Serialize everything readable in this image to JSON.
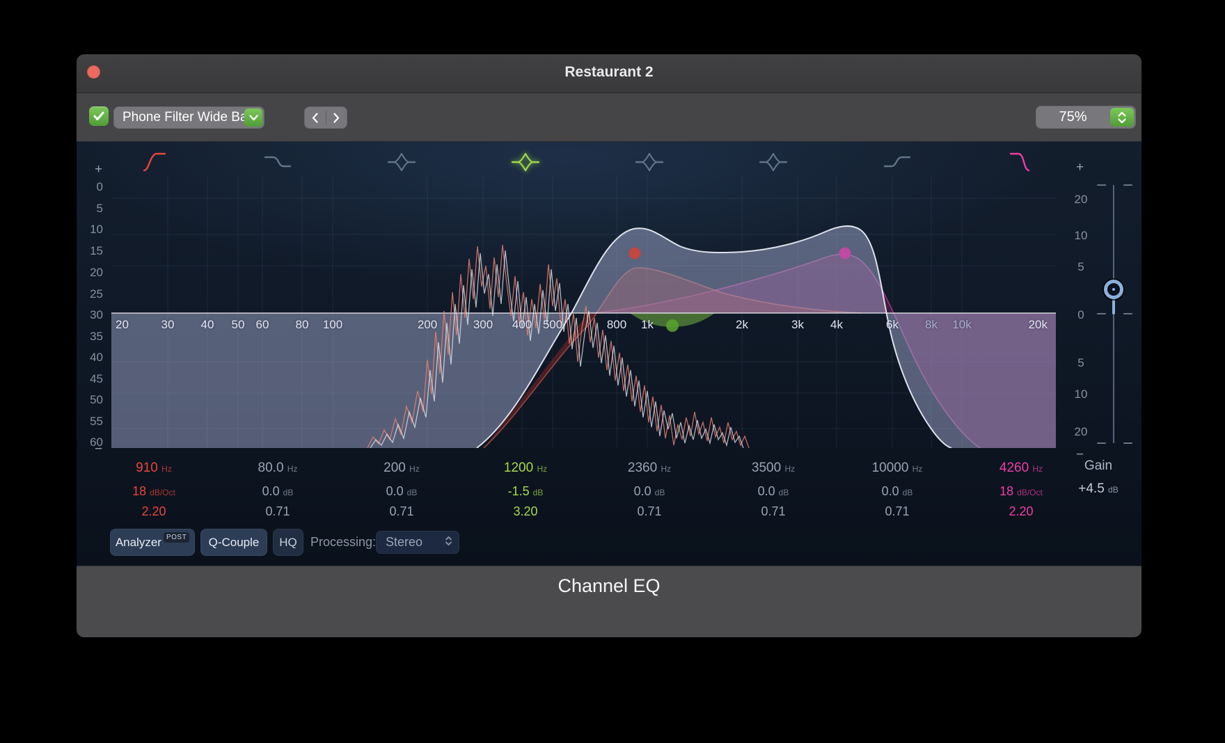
{
  "window": {
    "title": "Restaurant 2",
    "plugin_name": "Channel EQ"
  },
  "toolbar": {
    "preset": "Phone Filter Wide Ba...",
    "prev": "‹",
    "next": "›",
    "zoom": "75%"
  },
  "bands": [
    {
      "id": 1,
      "type": "highpass",
      "freq": "910",
      "freq_unit": "Hz",
      "gain": "18",
      "gain_unit": "dB/Oct",
      "q": "2.20",
      "color": "#e8453c",
      "selected": false
    },
    {
      "id": 2,
      "type": "low-shelf",
      "freq": "80.0",
      "freq_unit": "Hz",
      "gain": "0.0",
      "gain_unit": "dB",
      "q": "0.71",
      "color": "#98a3b3",
      "selected": false
    },
    {
      "id": 3,
      "type": "bell",
      "freq": "200",
      "freq_unit": "Hz",
      "gain": "0.0",
      "gain_unit": "dB",
      "q": "0.71",
      "color": "#98a3b3",
      "selected": false
    },
    {
      "id": 4,
      "type": "bell",
      "freq": "1200",
      "freq_unit": "Hz",
      "gain": "-1.5",
      "gain_unit": "dB",
      "q": "3.20",
      "color": "#a5d94d",
      "selected": true
    },
    {
      "id": 5,
      "type": "bell",
      "freq": "2360",
      "freq_unit": "Hz",
      "gain": "0.0",
      "gain_unit": "dB",
      "q": "0.71",
      "color": "#98a3b3",
      "selected": false
    },
    {
      "id": 6,
      "type": "bell",
      "freq": "3500",
      "freq_unit": "Hz",
      "gain": "0.0",
      "gain_unit": "dB",
      "q": "0.71",
      "color": "#98a3b3",
      "selected": false
    },
    {
      "id": 7,
      "type": "high-shelf",
      "freq": "10000",
      "freq_unit": "Hz",
      "gain": "0.0",
      "gain_unit": "dB",
      "q": "0.71",
      "color": "#98a3b3",
      "selected": false
    },
    {
      "id": 8,
      "type": "lowpass",
      "freq": "4260",
      "freq_unit": "Hz",
      "gain": "18",
      "gain_unit": "dB/Oct",
      "q": "2.20",
      "color": "#ee3da6",
      "selected": false
    }
  ],
  "master_gain": {
    "label": "Gain",
    "value": "+4.5",
    "unit": "dB"
  },
  "controls": {
    "analyzer": "Analyzer",
    "analyzer_mode": "POST",
    "q_couple": "Q-Couple",
    "hq": "HQ",
    "processing_label": "Processing:",
    "processing_value": "Stereo"
  },
  "scales": {
    "freq_labels": [
      "20",
      "30",
      "40",
      "50",
      "60",
      "80",
      "100",
      "200",
      "300",
      "400",
      "500",
      "800",
      "1k",
      "2k",
      "3k",
      "4k",
      "6k",
      "8k",
      "10k",
      "20k"
    ],
    "analyzer_db_labels": [
      "0",
      "5",
      "10",
      "15",
      "20",
      "25",
      "30",
      "35",
      "40",
      "45",
      "50",
      "55",
      "60"
    ],
    "gain_db_labels": [
      "20",
      "10",
      "5",
      "0",
      "5",
      "10",
      "20"
    ],
    "plus": "+",
    "minus": "−"
  },
  "colors": {
    "accent_green": "#6ab84c",
    "band_red": "#e8453c",
    "band_green": "#a5d94d",
    "band_magenta": "#ee3da6",
    "curve_fill": "rgba(168,175,214,0.48)",
    "analyzer_white": "rgba(230,235,242,0.75)",
    "analyzer_salmon": "rgba(240,130,115,0.8)"
  }
}
